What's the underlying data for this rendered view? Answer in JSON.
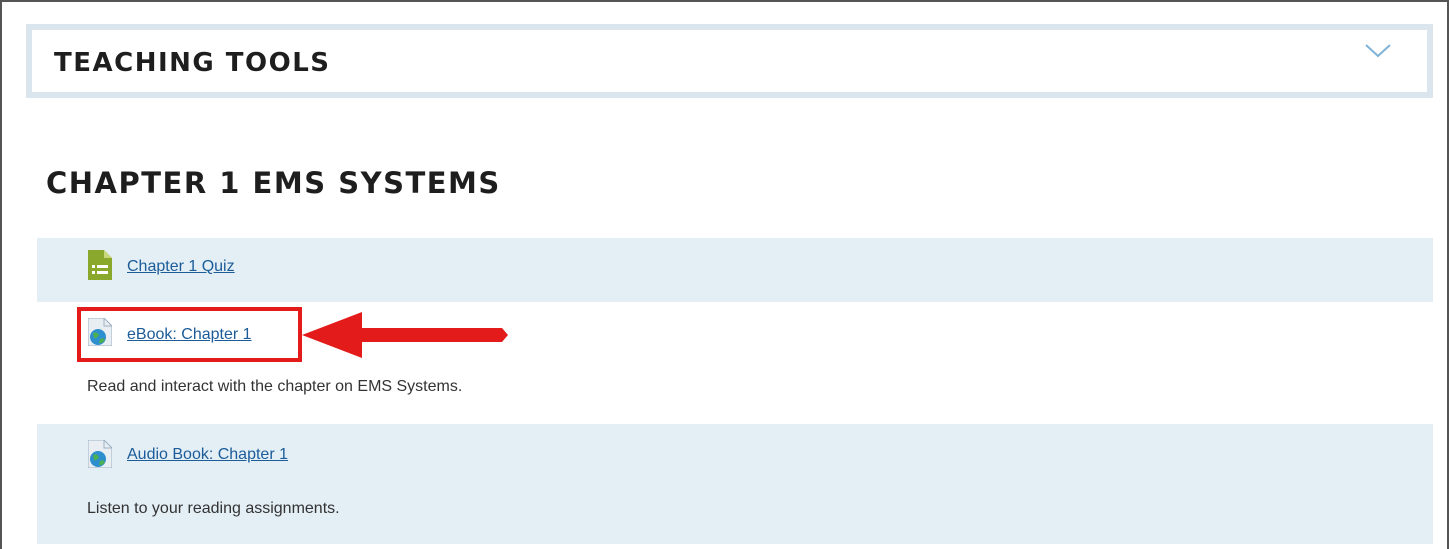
{
  "teaching_tools": {
    "title": "TEACHING TOOLS",
    "expand_icon": "chevron-down-icon"
  },
  "chapter": {
    "title": "CHAPTER 1 EMS SYSTEMS",
    "items": [
      {
        "label": "Chapter 1 Quiz",
        "icon": "quiz-icon",
        "description": ""
      },
      {
        "label": "eBook: Chapter 1",
        "icon": "url-globe-icon",
        "description": "Read and interact with the chapter on EMS Systems."
      },
      {
        "label": "Audio Book: Chapter 1",
        "icon": "url-globe-icon",
        "description": "Listen to your reading assignments."
      }
    ]
  },
  "annotation": {
    "highlight_color": "#e31b1b"
  },
  "colors": {
    "link": "#1b5c99",
    "row_shade": "#e3eef5",
    "quiz_icon": "#8aa82b"
  }
}
